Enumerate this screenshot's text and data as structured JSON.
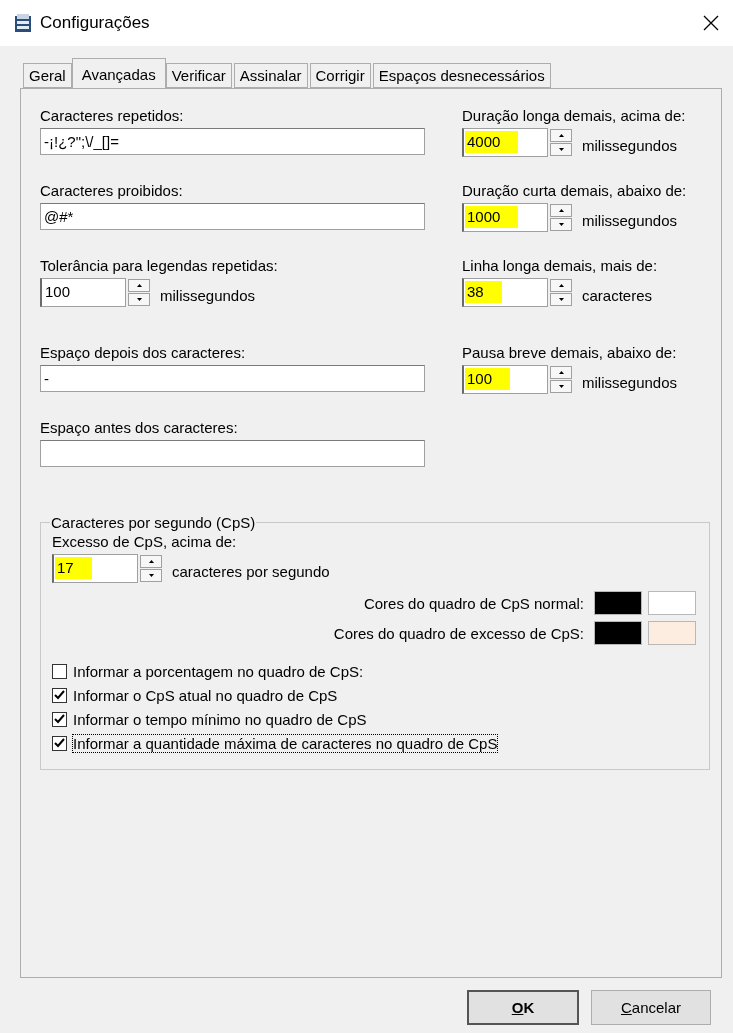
{
  "window": {
    "title": "Configurações"
  },
  "tabs": [
    {
      "label": "Geral",
      "selected": false
    },
    {
      "label": "Avançadas",
      "selected": true
    },
    {
      "label": "Verificar",
      "selected": false
    },
    {
      "label": "Assinalar",
      "selected": false
    },
    {
      "label": "Corrigir",
      "selected": false
    },
    {
      "label": "Espaços desnecessários",
      "selected": false
    }
  ],
  "left_fields": [
    {
      "kind": "text",
      "label": "Caracteres repetidos:",
      "value": "-¡!¿?\";\\/_[]="
    },
    {
      "kind": "text",
      "label": "Caracteres proibidos:",
      "value": "@#*"
    },
    {
      "kind": "spinner",
      "label": "Tolerância para legendas repetidas:",
      "value": "100",
      "unit": "milissegundos",
      "highlighted": false
    },
    {
      "kind": "text",
      "label": "Espaço depois dos caracteres:",
      "value": "-"
    },
    {
      "kind": "text",
      "label": "Espaço antes dos caracteres:"
    }
  ],
  "right_fields": [
    {
      "kind": "spinner",
      "label": "Duração longa demais, acima de:",
      "value": "4000",
      "unit": "milissegundos",
      "highlighted": true
    },
    {
      "kind": "spinner",
      "label": "Duração curta demais, abaixo de:",
      "value": "1000",
      "unit": "milissegundos",
      "highlighted": true
    },
    {
      "kind": "spinner",
      "label": "Linha longa demais, mais de:",
      "value": "38",
      "unit": "caracteres",
      "highlighted": true
    },
    {
      "kind": "spinner",
      "label": "Pausa breve demais, abaixo de:",
      "value": "100",
      "unit": "milissegundos",
      "highlighted": true
    }
  ],
  "cps_group": {
    "title": "Caracteres por segundo (CpS)",
    "excess": {
      "label": "Excesso de CpS, acima de:",
      "value": "17",
      "unit": "caracteres por segundo",
      "highlighted": true
    },
    "color_rows": [
      {
        "label": "Cores do quadro de CpS normal:",
        "swatches": [
          {
            "color": "#000000"
          },
          {
            "color": "#ffffff"
          }
        ]
      },
      {
        "label": "Cores do quadro de excesso de CpS:",
        "swatches": [
          {
            "color": "#000000"
          },
          {
            "color": "#fdede0"
          }
        ]
      }
    ],
    "checkboxes": [
      {
        "label": "Informar a porcentagem no quadro de CpS:",
        "checked": false,
        "focused": false
      },
      {
        "label": "Informar o CpS atual no quadro de CpS",
        "checked": true,
        "focused": false
      },
      {
        "label": "Informar o tempo mínimo no quadro de CpS",
        "checked": true,
        "focused": false
      },
      {
        "label": "Informar a quantidade máxima de caracteres no quadro de CpS",
        "checked": true,
        "focused": true
      }
    ]
  },
  "buttons": [
    {
      "label": "OK",
      "default": true
    },
    {
      "label": "Cancelar",
      "default": false
    }
  ]
}
